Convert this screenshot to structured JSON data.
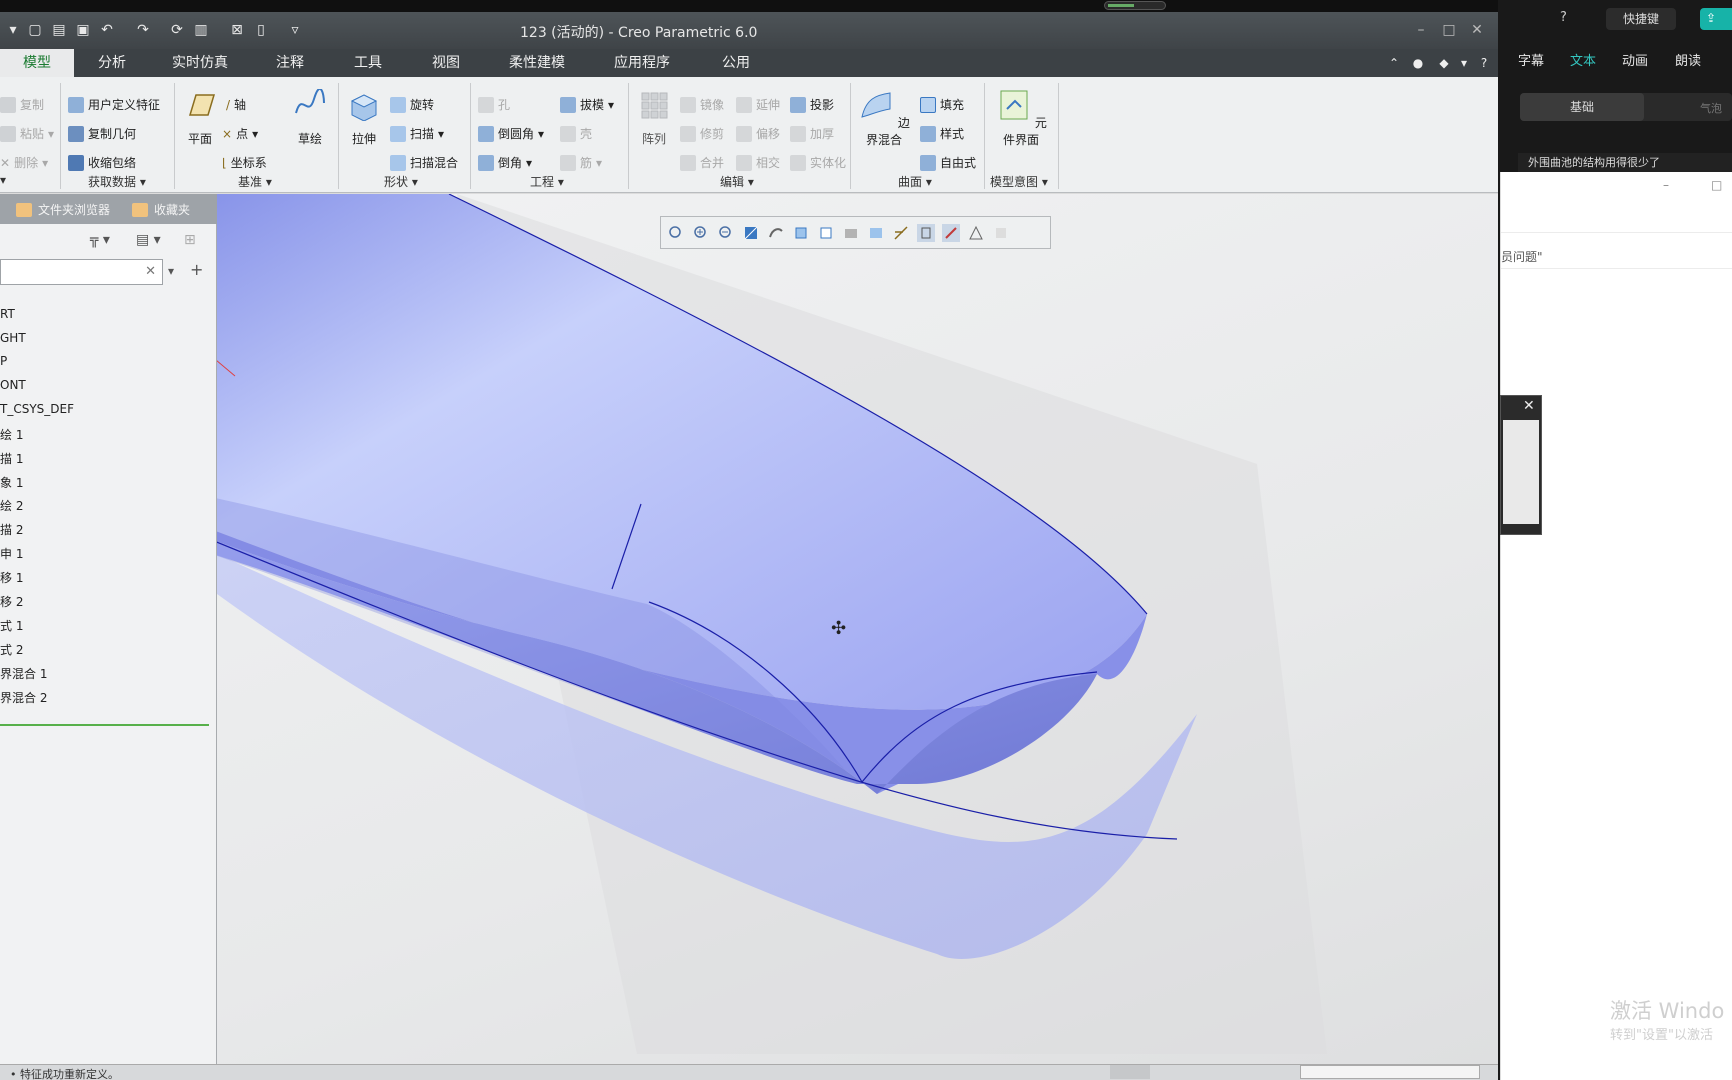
{
  "window": {
    "title": "123 (活动的) - Creo Parametric 6.0"
  },
  "menu_tabs": [
    "模型",
    "分析",
    "实时仿真",
    "注释",
    "工具",
    "视图",
    "柔性建模",
    "应用程序",
    "公用"
  ],
  "ribbon": {
    "clipboard": {
      "copy": "复制",
      "paste": "粘贴",
      "delete": "删除"
    },
    "get_data": {
      "udf": "用户定义特征",
      "copy_geom": "复制几何",
      "shrinkwrap": "收缩包络",
      "group": "获取数据"
    },
    "datum": {
      "plane": "平面",
      "axis": "轴",
      "point": "点",
      "csys": "坐标系",
      "sketch": "草绘",
      "group": "基准"
    },
    "shapes": {
      "extrude": "拉伸",
      "revolve": "旋转",
      "sweep": "扫描",
      "swept_blend": "扫描混合",
      "group": "形状"
    },
    "engineering": {
      "hole": "孔",
      "round": "倒圆角",
      "chamfer": "倒角",
      "draft": "拔模",
      "shell": "壳",
      "rib": "筋",
      "group": "工程"
    },
    "editing": {
      "pattern": "阵列",
      "mirror": "镜像",
      "trim": "修剪",
      "merge": "合并",
      "extend": "延伸",
      "offset": "偏移",
      "intersect": "相交",
      "project": "投影",
      "thicken": "加厚",
      "solidify": "实体化",
      "group": "编辑"
    },
    "surfaces": {
      "boundary_blend": "边界混合",
      "fill": "填充",
      "style": "样式",
      "freestyle": "自由式",
      "group": "曲面"
    },
    "model_intent": {
      "component_interface": "元件界面",
      "group": "模型意图"
    }
  },
  "left_panel": {
    "tabs": [
      "文件夹浏览器",
      "收藏夹"
    ],
    "search_value": "",
    "tree": [
      "RT",
      "GHT",
      "P",
      "ONT",
      "T_CSYS_DEF",
      "绘 1",
      "描 1",
      "象 1",
      "绘 2",
      "描 2",
      "申 1",
      "移 1",
      "移 2",
      "式 1",
      "式 2",
      "界混合 1",
      "界混合 2"
    ]
  },
  "status": {
    "message": "• 特征成功重新定义。"
  },
  "right_app": {
    "shortcut_btn": "快捷键",
    "tabs": [
      "字幕",
      "文本",
      "动画",
      "朗读"
    ],
    "active_tab": "文本",
    "segments": [
      "基础",
      "气泡"
    ],
    "strip_text": "外围曲池的结构用得很少了",
    "field_label": "员问题\"",
    "watermark_line1": "激活 Windo",
    "watermark_line2": "转到\"设置\"以激活"
  },
  "colors": {
    "accent_green": "#1a7a30",
    "surface_blue": "#8f97ef",
    "teal": "#34c6c0"
  }
}
